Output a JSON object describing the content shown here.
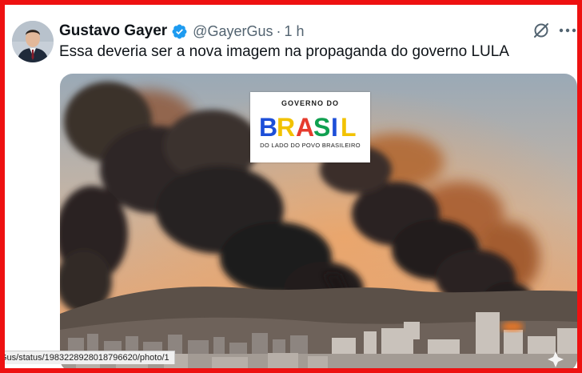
{
  "tweet": {
    "author_name": "Gustavo Gayer",
    "handle": "@GayerGus",
    "separator": "·",
    "time": "1 h",
    "text": "Essa deveria ser a nova imagem na propaganda do governo LULA"
  },
  "media": {
    "logo": {
      "top_text": "GOVERNO DO",
      "word": "BRASIL",
      "bottom_text": "DO LADO DO POVO BRASILEIRO",
      "letter_colors": [
        "#1d4fd8",
        "#f2c200",
        "#e63b2e",
        "#10a050",
        "#1d4fd8",
        "#f2c200"
      ]
    }
  },
  "status_bar": {
    "url": "Gus/status/1983228928018796620/photo/1"
  },
  "icons": {
    "verified": "verified-badge-icon",
    "grok": "grok-icon",
    "more": "more-options-icon"
  },
  "colors": {
    "frame": "#ee1111",
    "verified": "#1d9bf0",
    "text": "#0f1419",
    "secondary": "#536471"
  }
}
